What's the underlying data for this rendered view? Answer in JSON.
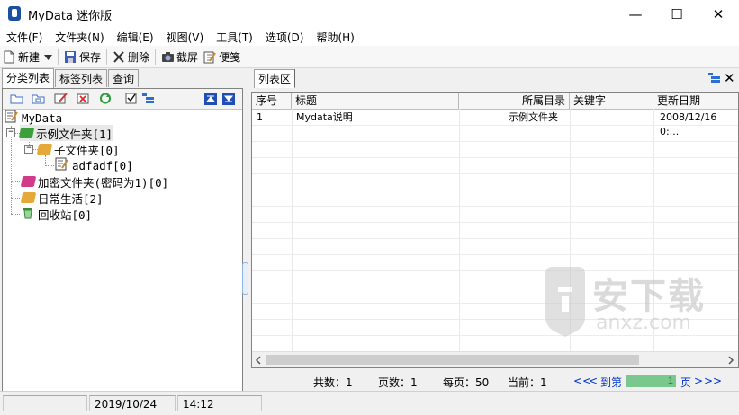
{
  "window": {
    "title": "MyData  迷你版",
    "controls": {
      "minimize": "—",
      "maximize": "☐",
      "close": "✕"
    }
  },
  "menu": [
    "文件(F)",
    "文件夹(N)",
    "编辑(E)",
    "视图(V)",
    "工具(T)",
    "选项(D)",
    "帮助(H)"
  ],
  "toolbar": {
    "new_label": "新建",
    "save_label": "保存",
    "delete_label": "删除",
    "screenshot_label": "截屏",
    "note_label": "便笺"
  },
  "left_tabs": [
    "分类列表",
    "标签列表",
    "查询"
  ],
  "tree": {
    "root": "MyData",
    "nodes": [
      {
        "label": "示例文件夹[1]",
        "color": "#3aa03a"
      },
      {
        "label": "子文件夹[0]",
        "color": "#e5a93a"
      },
      {
        "label": "adfadf[0]",
        "color": ""
      },
      {
        "label": "加密文件夹(密码为1)[0]",
        "color": "#d23a8a"
      },
      {
        "label": "日常生活[2]",
        "color": "#e5a93a"
      },
      {
        "label": "回收站[0]",
        "color": ""
      }
    ]
  },
  "right_tab": "列表区",
  "grid": {
    "columns": [
      "序号",
      "标题",
      "所属目录",
      "关键字",
      "更新日期"
    ],
    "rows": [
      {
        "index": "1",
        "title": "Mydata说明",
        "dir": "示例文件夹",
        "keywords": "",
        "date": "2008/12/16 0:..."
      }
    ]
  },
  "pager": {
    "total_label": "共数：1",
    "pages_label": "页数：1",
    "per_page_label": "每页：50",
    "current_label": "当前：1",
    "first": "<<",
    "prev": "<",
    "goto_label": "到第",
    "page_value": "1",
    "page_suffix": "页",
    "next": ">",
    "last": ">>"
  },
  "status": {
    "cell1": "",
    "date": "2019/10/24",
    "time": "14:12"
  },
  "watermark": {
    "main": "安下载",
    "sub": "anxz.com"
  },
  "colors": {
    "link": "#0033cc",
    "page_box": "#7ac88e"
  }
}
